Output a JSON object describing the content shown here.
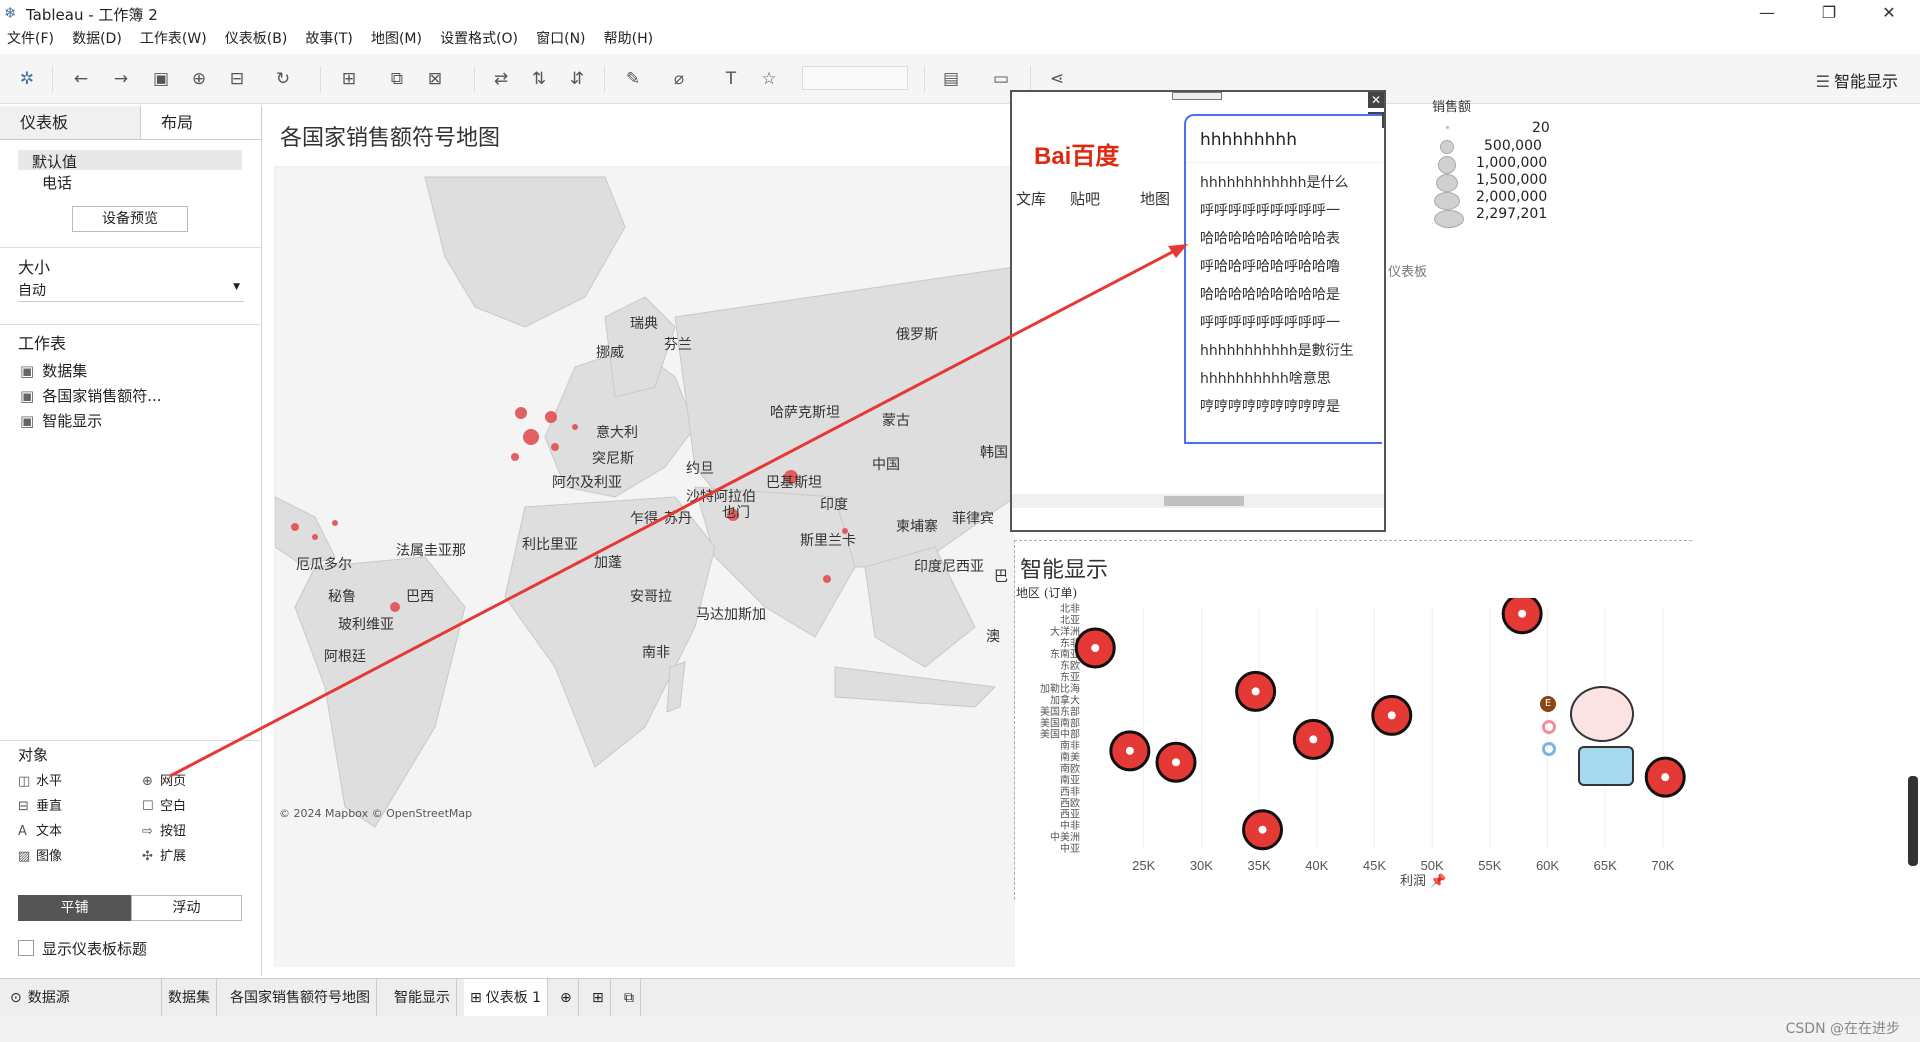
{
  "window": {
    "title": "Tableau - 工作簿 2"
  },
  "menu": [
    "文件(F)",
    "数据(D)",
    "工作表(W)",
    "仪表板(B)",
    "故事(T)",
    "地图(M)",
    "设置格式(O)",
    "窗口(N)",
    "帮助(H)"
  ],
  "toolbar": {
    "smart_label": "智能显示"
  },
  "left_panel": {
    "tabs": [
      "仪表板",
      "布局"
    ],
    "device": {
      "default": "默认值",
      "phone": "电话",
      "preview_button": "设备预览"
    },
    "size": {
      "heading": "大小",
      "value": "自动"
    },
    "worksheets": {
      "heading": "工作表",
      "items": [
        "数据集",
        "各国家销售额符...",
        "智能显示"
      ]
    },
    "objects": {
      "heading": "对象",
      "items": [
        "水平",
        "网页",
        "垂直",
        "空白",
        "文本",
        "按钮",
        "图像",
        "扩展"
      ]
    },
    "mode": {
      "tiled": "平铺",
      "floating": "浮动"
    },
    "show_title": "显示仪表板标题"
  },
  "map": {
    "title": "各国家销售额符号地图",
    "attribution": "© 2024 Mapbox © OpenStreetMap",
    "labels": [
      "瑞典",
      "芬兰",
      "挪威",
      "俄罗斯",
      "意大利",
      "哈萨克斯坦",
      "蒙古",
      "中国",
      "韩国",
      "突尼斯",
      "阿尔及利亚",
      "约旦",
      "沙特阿拉伯",
      "巴基斯坦",
      "印度",
      "菲律宾",
      "柬埔寨",
      "也门",
      "苏丹",
      "乍得",
      "利比里亚",
      "斯里兰卡",
      "法属圭亚那",
      "厄瓜多尔",
      "加蓬",
      "印度尼西亚",
      "巴西",
      "秘鲁",
      "安哥拉",
      "马达加斯加",
      "玻利维亚",
      "阿根廷",
      "南非",
      "澳大利亚",
      "巴布亚"
    ],
    "labels_vis": [
      "瑞典",
      "芬兰",
      "挪威",
      "俄罗斯",
      "意大利",
      "哈萨克斯坦",
      "蒙古",
      "中国",
      "韩国",
      "突尼斯",
      "阿尔及利亚",
      "约旦",
      "沙特阿拉伯",
      "巴基斯坦",
      "印度",
      "菲律宾",
      "柬埔寨",
      "也门",
      "苏丹",
      "乍得",
      "利比里亚",
      "斯里兰卡",
      "法属圭亚那",
      "厄瓜多尔",
      "加蓬",
      "印度尼西亚",
      "巴西",
      "秘鲁",
      "安哥拉",
      "马达加斯加",
      "玻利维亚",
      "阿根廷",
      "南非",
      "澳",
      "巴"
    ]
  },
  "web_object": {
    "logo": "Bai百度",
    "search_text": "hhhhhhhhh",
    "nav": [
      "文库",
      "贴吧",
      "地图"
    ],
    "suggestions": [
      "hhhhhhhhhhhh是什么",
      "呼呼呼呼呼呼呼呼呼一",
      "哈哈哈哈哈哈哈哈哈表",
      "呼哈哈呼哈哈呼哈哈噜",
      "哈哈哈哈哈哈哈哈哈是",
      "呼呼呼呼呼呼呼呼呼一",
      "hhhhhhhhhhh是數衍生",
      "hhhhhhhhhh啥意思",
      "哼哼哼哼哼哼哼哼哼是"
    ],
    "side_label": "仪表板"
  },
  "legend": {
    "title": "销售额",
    "entries": [
      "20",
      "500,000",
      "1,000,000",
      "1,500,000",
      "2,000,000",
      "2,297,201"
    ]
  },
  "chart_data": {
    "type": "scatter",
    "title": "智能显示",
    "xlabel": "利润",
    "ylabel": "地区 (订单)",
    "xlim": [
      20000,
      72000
    ],
    "x_ticks": [
      "25K",
      "30K",
      "35K",
      "40K",
      "45K",
      "50K",
      "55K",
      "60K",
      "65K",
      "70K"
    ],
    "y_categories": [
      "北非",
      "北亚",
      "大洋洲",
      "东非",
      "东南亚",
      "东欧",
      "东亚",
      "加勒比海",
      "加拿大",
      "美国东部",
      "美国南部",
      "美国中部",
      "南非",
      "南美",
      "南欧",
      "南亚",
      "西非",
      "西欧",
      "西亚",
      "中非",
      "中美洲",
      "中亚"
    ],
    "points": [
      {
        "x": 57800,
        "y": 0.5
      },
      {
        "x": 20800,
        "y": 3.5
      },
      {
        "x": 34700,
        "y": 7.3
      },
      {
        "x": 46500,
        "y": 9.4
      },
      {
        "x": 39700,
        "y": 11.5
      },
      {
        "x": 23800,
        "y": 12.5
      },
      {
        "x": 27800,
        "y": 13.5
      },
      {
        "x": 70200,
        "y": 14.8
      },
      {
        "x": 35300,
        "y": 19.4
      }
    ]
  },
  "bottom_tabs": [
    "数据源",
    "数据集",
    "各国家销售额符号地图",
    "智能显示",
    "仪表板 1"
  ],
  "watermark": "CSDN @在在进步"
}
